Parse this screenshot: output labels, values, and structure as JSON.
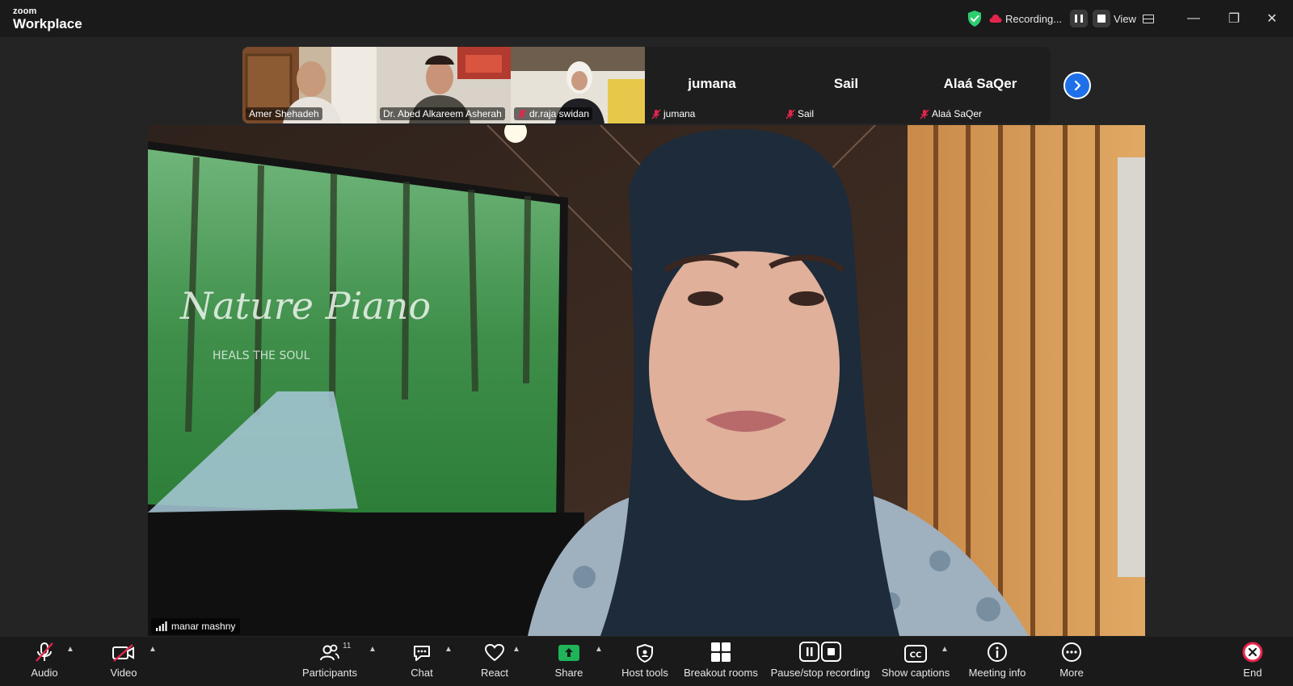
{
  "app": {
    "brand_small": "zoom",
    "brand_big": "Workplace"
  },
  "titlebar": {
    "recording_label": "Recording...",
    "view_label": "View",
    "minimize": "—",
    "restore": "❐",
    "close": "✕"
  },
  "strip": {
    "tiles": [
      {
        "name": "Amer Shehadeh",
        "has_video": true,
        "muted": false
      },
      {
        "name": "Dr. Abed Alkareem Asherah",
        "has_video": true,
        "muted": false
      },
      {
        "name": "dr.raja swidan",
        "has_video": true,
        "muted": true
      },
      {
        "name": "jumana",
        "has_video": false,
        "muted": true,
        "big_name": "jumana"
      },
      {
        "name": "Sail",
        "has_video": false,
        "muted": true,
        "big_name": "Sail"
      },
      {
        "name": "Alaá SaQer",
        "has_video": false,
        "muted": true,
        "big_name": "Alaá SaQer"
      }
    ]
  },
  "main": {
    "speaker_name": "manar mashny",
    "poster_title": "Nature Piano",
    "poster_subtitle": "HEALS THE SOUL"
  },
  "toolbar": {
    "audio": "Audio",
    "video": "Video",
    "participants": "Participants",
    "participants_count": "11",
    "chat": "Chat",
    "react": "React",
    "share": "Share",
    "host_tools": "Host tools",
    "breakout_rooms": "Breakout rooms",
    "pause_stop_recording": "Pause/stop recording",
    "show_captions": "Show captions",
    "meeting_info": "Meeting info",
    "more": "More",
    "end": "End"
  },
  "colors": {
    "accent_blue": "#1e6fe8",
    "share_green": "#1fb35a",
    "end_red": "#e5254d",
    "shield_green": "#2ecc71"
  }
}
